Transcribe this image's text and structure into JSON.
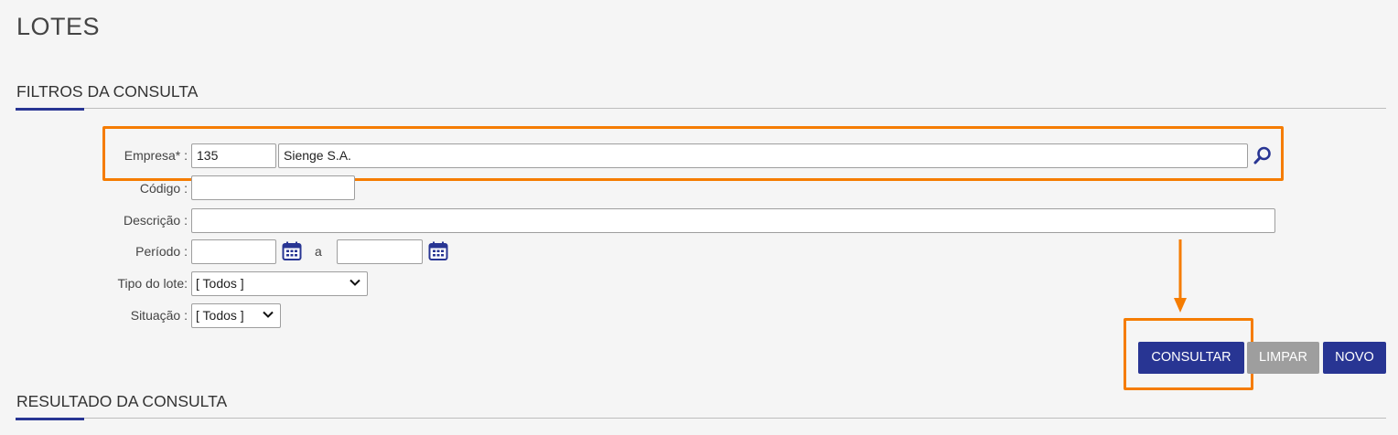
{
  "page": {
    "title": "LOTES"
  },
  "filters": {
    "section_title": "FILTROS DA CONSULTA",
    "empresa": {
      "label": "Empresa* :",
      "code": "135",
      "name": "Sienge S.A.",
      "search_icon": "search-icon"
    },
    "codigo": {
      "label": "Código :",
      "value": ""
    },
    "descricao": {
      "label": "Descrição :",
      "value": ""
    },
    "periodo": {
      "label": "Período :",
      "start": "",
      "separator": "a",
      "end": "",
      "calendar_icon": "calendar-icon"
    },
    "tipo_lote": {
      "label": "Tipo do lote:",
      "selected": "[ Todos ]"
    },
    "situacao": {
      "label": "Situação :",
      "selected": "[ Todos ]"
    }
  },
  "actions": {
    "consultar": "CONSULTAR",
    "limpar": "LIMPAR",
    "novo": "NOVO"
  },
  "results": {
    "section_title": "RESULTADO DA CONSULTA"
  },
  "colors": {
    "primary": "#283593",
    "disabled": "#9e9e9e",
    "highlight": "#f57c00"
  }
}
